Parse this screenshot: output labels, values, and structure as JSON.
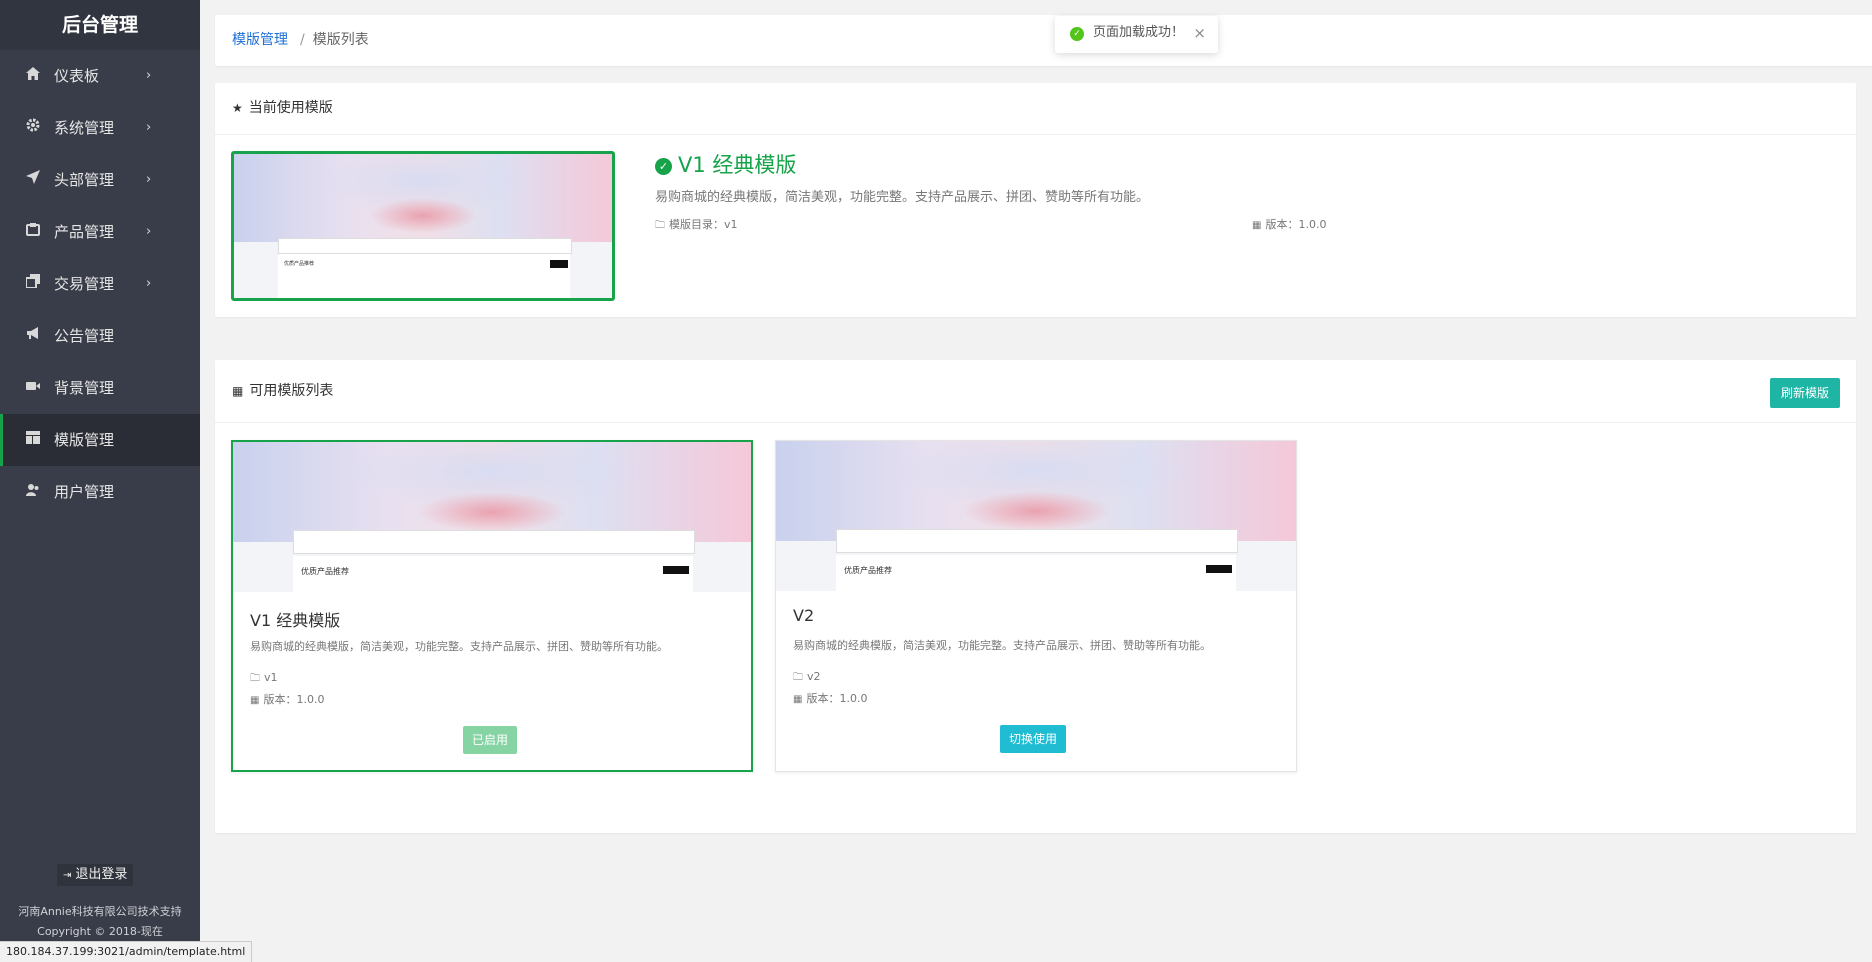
{
  "sidebar": {
    "brand": "后台管理",
    "items": [
      {
        "label": "仪表板",
        "icon": "home-icon",
        "arrow": true
      },
      {
        "label": "系统管理",
        "icon": "gear-icon",
        "arrow": true
      },
      {
        "label": "头部管理",
        "icon": "send-icon",
        "arrow": true
      },
      {
        "label": "产品管理",
        "icon": "product-icon",
        "arrow": true
      },
      {
        "label": "交易管理",
        "icon": "copy-icon",
        "arrow": true
      },
      {
        "label": "公告管理",
        "icon": "megaphone-icon",
        "arrow": false
      },
      {
        "label": "背景管理",
        "icon": "video-icon",
        "arrow": false
      },
      {
        "label": "模版管理",
        "icon": "layout-icon",
        "arrow": false,
        "active": true
      },
      {
        "label": "用户管理",
        "icon": "users-icon",
        "arrow": false
      }
    ],
    "logout": "退出登录",
    "support_line1": "河南Annie科技有限公司技术支持",
    "support_line2": "Copyright © 2018-现在"
  },
  "breadcrumb": {
    "parent": "模版管理",
    "separator": "/",
    "current": "模版列表"
  },
  "toast": {
    "message": "页面加载成功！",
    "close": "×"
  },
  "current_template": {
    "header": "当前使用模版",
    "title": "V1 经典模版",
    "description": "易购商城的经典模版，简洁美观，功能完整。支持产品展示、拼团、赞助等所有功能。",
    "dir_label": "模版目录：v1",
    "version_label": "版本：1.0.0"
  },
  "template_list": {
    "header": "可用模版列表",
    "refresh_button": "刷新模版",
    "items": [
      {
        "title": "V1 经典模版",
        "description": "易购商城的经典模版，简洁美观，功能完整。支持产品展示、拼团、赞助等所有功能。",
        "dir": "v1",
        "version": "版本：1.0.0",
        "button": "已启用",
        "current": true
      },
      {
        "title": "V2",
        "description": "易购商城的经典模版，简洁美观，功能完整。支持产品展示、拼团、赞助等所有功能。",
        "dir": "v2",
        "version": "版本：1.0.0",
        "button": "切换使用",
        "current": false
      }
    ]
  },
  "thumbnail": {
    "product_heading": "优质产品推荐"
  },
  "colors": {
    "sidebar_bg": "#393d49",
    "accent_green": "#16a34a",
    "teal_button": "#1fb5a5",
    "switch_button": "#1fbcd2",
    "link_blue": "#1e6fd9"
  },
  "statusbar": {
    "url": "180.184.37.199:3021/admin/template.html"
  }
}
